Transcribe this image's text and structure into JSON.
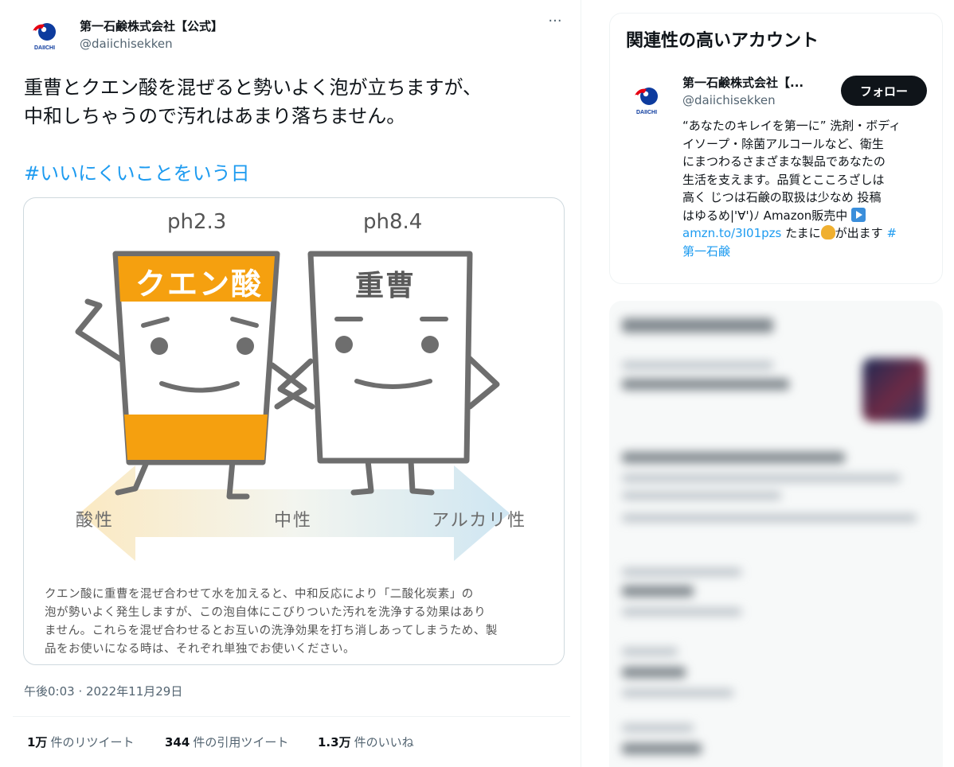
{
  "tweet": {
    "author_name": "第一石鹸株式会社【公式】",
    "author_handle": "@daiichisekken",
    "more_icon": "more-dots-icon",
    "text_lines": [
      "重曹とクエン酸を混ぜると勢いよく泡が立ちますが、",
      "中和しちゃうので汚れはあまり落ちません。"
    ],
    "hashtag": "#いいにくいことをいう日",
    "timestamp": "午後0:03 · 2022年11月29日",
    "stats": {
      "retweets_count": "1万",
      "retweets_label": "件のリツイート",
      "quotes_count": "344",
      "quotes_label": "件の引用ツイート",
      "likes_count": "1.3万",
      "likes_label": "件のいいね"
    }
  },
  "media": {
    "left_ph": "ph2.3",
    "right_ph": "ph8.4",
    "left_name": "クエン酸",
    "right_name": "重曹",
    "scale_acid": "酸性",
    "scale_neutral": "中性",
    "scale_alkaline": "アルカリ性",
    "caption_lines": [
      "クエン酸に重曹を混ぜ合わせて水を加えると、中和反応により「二酸化炭素」の",
      "泡が勢いよく発生しますが、この泡自体にこびりついた汚れを洗浄する効果はあり",
      "ません。これらを混ぜ合わせるとお互いの洗浄効果を打ち消しあってしまうため、製",
      "品をお使いになる時は、それぞれ単独でお使いください。"
    ],
    "colors": {
      "orange": "#f5a00f",
      "outline": "#6e6e6e"
    }
  },
  "logo": {
    "text": "DAIICHI",
    "colors": {
      "red": "#e60012",
      "blue": "#0d3b9e"
    }
  },
  "sidebar": {
    "title": "関連性の高いアカウント",
    "account": {
      "name": "第一石鹸株式会社【...",
      "handle": "@daiichisekken",
      "follow_label": "フォロー",
      "bio_lines": [
        "“あなたのキレイを第一に” 洗剤・ボディ",
        "イソープ・除菌アルコールなど、衛生",
        "にまつわるさまざまな製品であなたの",
        "生活を支えます。品質とこころざしは",
        "高く じつは石鹸の取扱は少なめ 投稿",
        "はゆるめ|'∀')ﾉ Amazon販売中"
      ],
      "bio_link": "amzn.to/3I01pzs",
      "bio_after_link_1": " たまに",
      "bio_after_link_2": "が出ます ",
      "bio_hashtag_part1": "#",
      "bio_hashtag_part2": "第一石鹸"
    }
  }
}
